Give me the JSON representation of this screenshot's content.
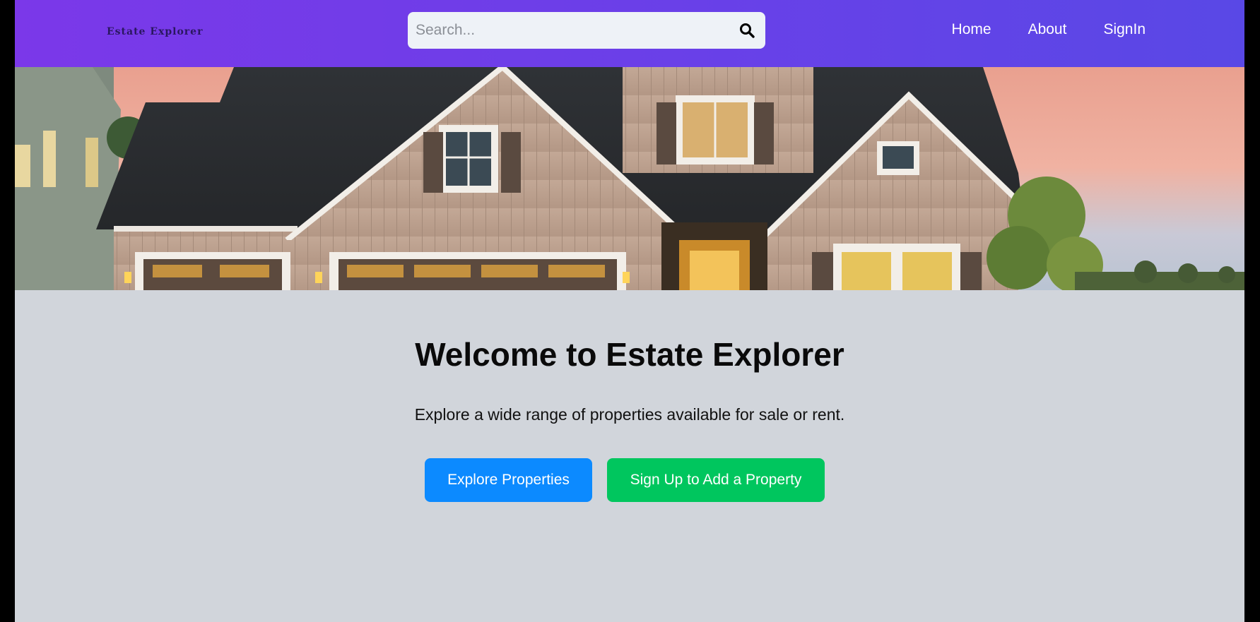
{
  "navbar": {
    "logo": "Estate Explorer",
    "search": {
      "placeholder": "Search...",
      "value": ""
    },
    "links": [
      "Home",
      "About",
      "SignIn"
    ]
  },
  "hero": {
    "main": {
      "title": "Welcome to Estate Explorer",
      "subtitle": "Explore a wide range of properties available for sale or rent.",
      "explore_button": "Explore Properties",
      "signup_button": "Sign Up to Add a Property"
    }
  },
  "colors": {
    "nav_gradient_start": "#7b38e9",
    "nav_gradient_end": "#5948e6",
    "page_background": "#d1d5db",
    "explore_button": "#0c8aff",
    "signup_button": "#00c65e"
  }
}
